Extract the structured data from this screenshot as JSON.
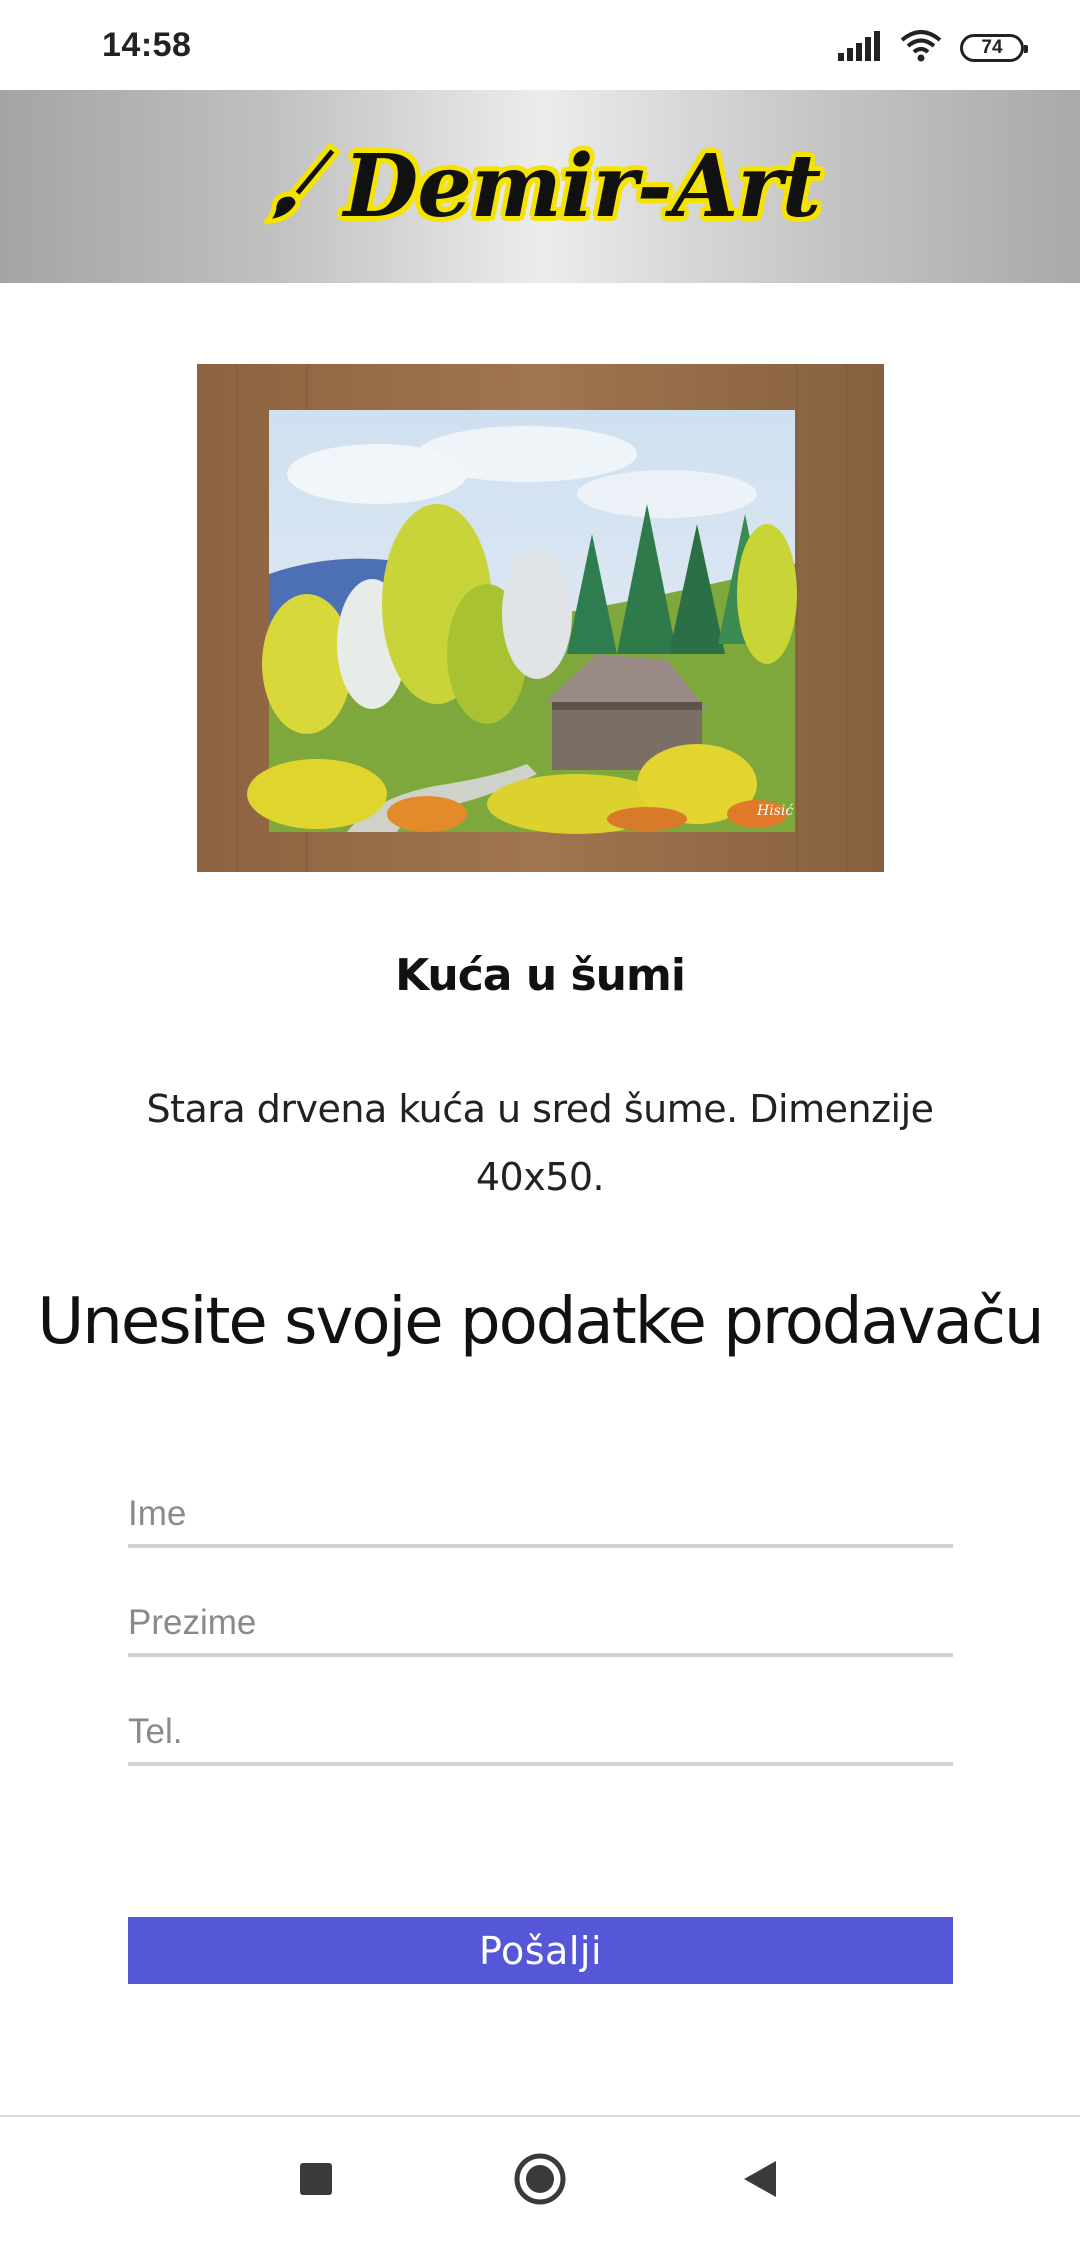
{
  "status_bar": {
    "time": "14:58",
    "battery": "74"
  },
  "header": {
    "logo_text": "Demir-Art",
    "background_color": "#c8c8c8",
    "logo_outline_color": "#f5e400"
  },
  "product": {
    "title": "Kuća u šumi",
    "description": "Stara drvena kuća u sred šume. Dimenzije 40x50."
  },
  "form": {
    "heading": "Unesite svoje podatke prodavaču",
    "fields": [
      {
        "placeholder": "Ime",
        "value": ""
      },
      {
        "placeholder": "Prezime",
        "value": ""
      },
      {
        "placeholder": "Tel.",
        "value": ""
      }
    ],
    "submit_label": "Pošalji",
    "submit_color": "#5656d8"
  },
  "nav_bar": {
    "icons": [
      "recents-icon",
      "home-icon",
      "back-icon"
    ]
  }
}
